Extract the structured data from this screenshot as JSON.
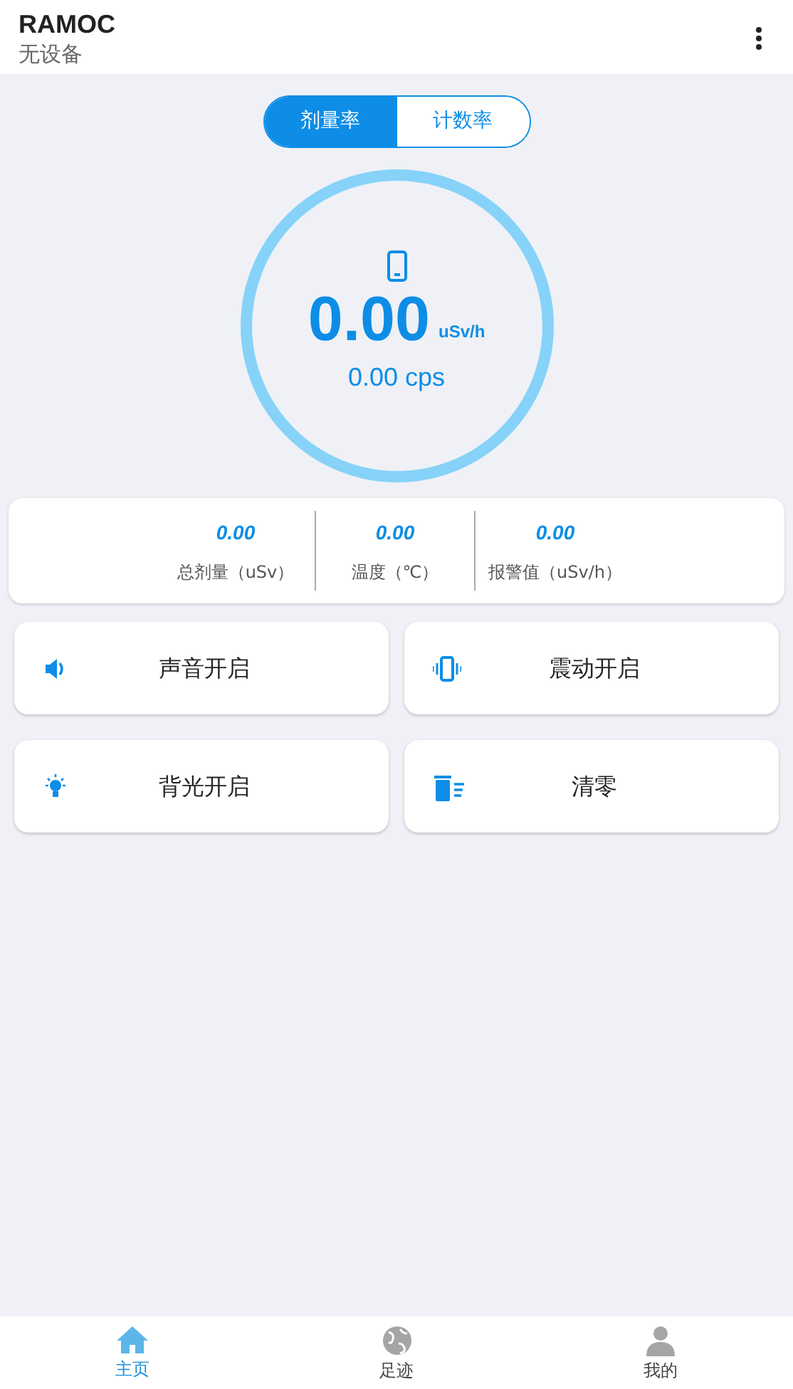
{
  "header": {
    "title": "RAMOC",
    "subtitle": "无设备"
  },
  "mode_tabs": [
    {
      "label": "剂量率",
      "selected": true
    },
    {
      "label": "计数率",
      "selected": false
    }
  ],
  "gauge": {
    "value": "0.00",
    "unit": "uSv/h",
    "secondary": "0.00 cps"
  },
  "stats": [
    {
      "value": "0.00",
      "label": "总剂量（uSv）"
    },
    {
      "value": "0.00",
      "label": "温度（℃）"
    },
    {
      "value": "0.00",
      "label": "报警值（uSv/h）"
    }
  ],
  "actions": [
    {
      "label": "声音开启"
    },
    {
      "label": "震动开启"
    },
    {
      "label": "背光开启"
    },
    {
      "label": "清零"
    }
  ],
  "bottom_nav": [
    {
      "label": "主页",
      "selected": true
    },
    {
      "label": "足迹",
      "selected": false
    },
    {
      "label": "我的",
      "selected": false
    }
  ]
}
